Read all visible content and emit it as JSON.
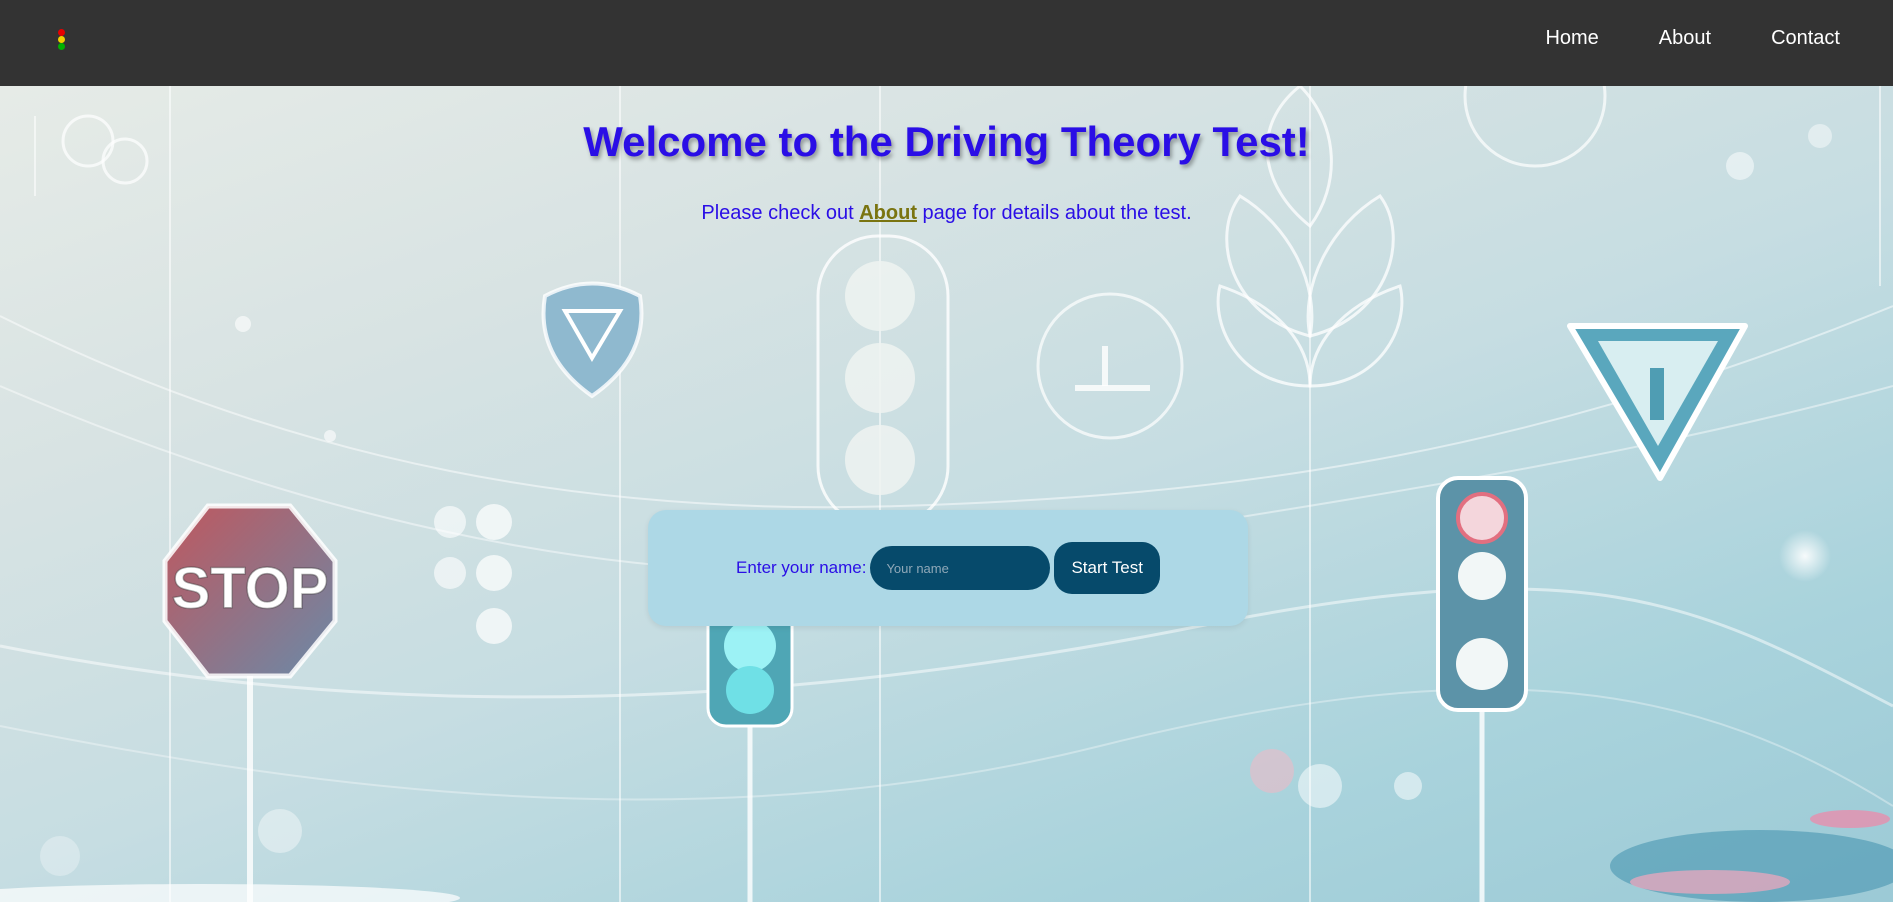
{
  "nav": {
    "links": [
      "Home",
      "About",
      "Contact"
    ]
  },
  "main": {
    "title": "Welcome to the Driving Theory Test!",
    "subtitle_before": "Please check out ",
    "subtitle_link": "About",
    "subtitle_after": " page for details about the test."
  },
  "form": {
    "label": "Enter your name:",
    "placeholder": "Your name",
    "button": "Start Test"
  },
  "background": {
    "stop_sign": "STOP"
  },
  "colors": {
    "navbar": "#333333",
    "heading": "#2a0ee6",
    "link": "#7a7410",
    "card": "#add8e6",
    "control": "#064a6b"
  }
}
